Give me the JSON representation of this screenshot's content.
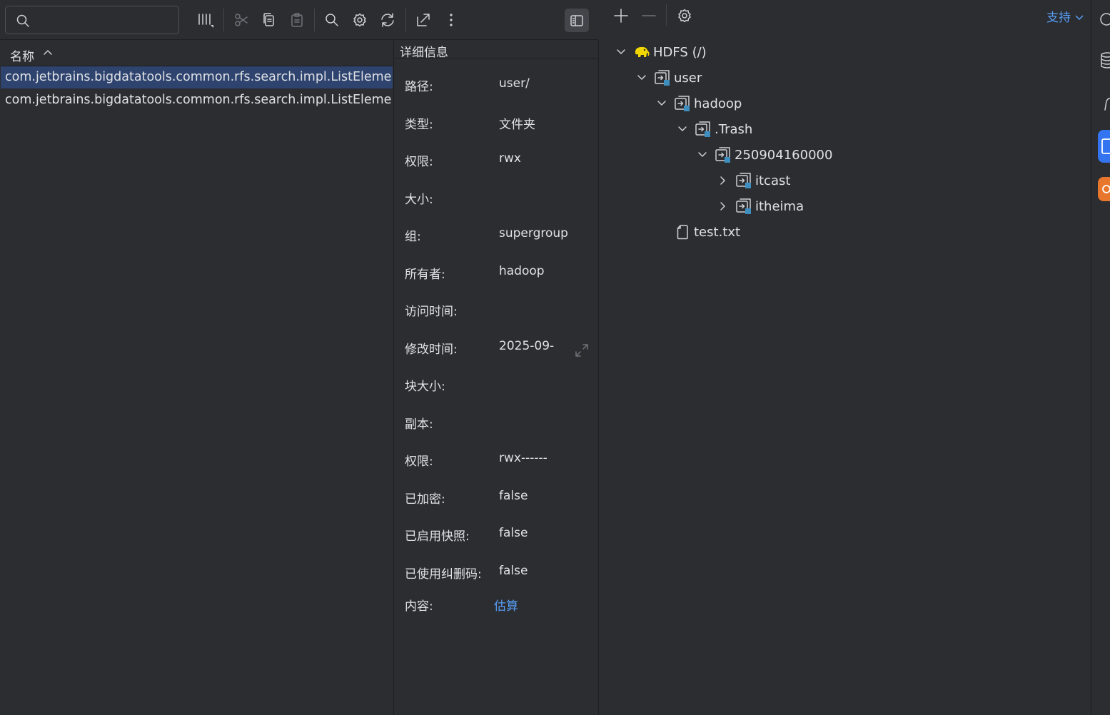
{
  "search": {
    "placeholder": "",
    "value": ""
  },
  "file_list": {
    "column_header": "名称",
    "rows": [
      {
        "name": "com.jetbrains.bigdatatools.common.rfs.search.impl.ListElementCo",
        "selected": true
      },
      {
        "name": "com.jetbrains.bigdatatools.common.rfs.search.impl.ListElementCo",
        "selected": false
      }
    ]
  },
  "details": {
    "title": "详细信息",
    "fields": [
      {
        "label": "路径:",
        "value": "user/"
      },
      {
        "label": "类型:",
        "value": "文件夹"
      },
      {
        "label": "权限:",
        "value": "rwx"
      },
      {
        "label": "大小:",
        "value": ""
      },
      {
        "label": "组:",
        "value": "supergroup"
      },
      {
        "label": "所有者:",
        "value": "hadoop"
      },
      {
        "label": "访问时间:",
        "value": ""
      },
      {
        "label": "修改时间:",
        "value": "2025-09-"
      },
      {
        "label": "块大小:",
        "value": ""
      },
      {
        "label": "副本:",
        "value": ""
      },
      {
        "label": "权限:",
        "value": "rwx------"
      },
      {
        "label": "已加密:",
        "value": "false"
      },
      {
        "label": "已启用快照:",
        "value": "false"
      },
      {
        "label": "已使用纠删码:",
        "value": "false"
      }
    ],
    "content_label": "内容:",
    "content_link": "估算"
  },
  "tree": {
    "support_label": "支持",
    "nodes": [
      {
        "label": "HDFS (/)",
        "type": "root",
        "expanded": true
      },
      {
        "label": "user",
        "type": "folder",
        "expanded": true
      },
      {
        "label": "hadoop",
        "type": "folder",
        "expanded": true
      },
      {
        "label": ".Trash",
        "type": "folder",
        "expanded": true
      },
      {
        "label": "250904160000",
        "type": "folder",
        "expanded": true
      },
      {
        "label": "itcast",
        "type": "folder",
        "expanded": false
      },
      {
        "label": "itheima",
        "type": "folder",
        "expanded": false
      },
      {
        "label": "test.txt",
        "type": "file"
      }
    ]
  },
  "colors": {
    "background": "#2b2d30",
    "selection": "#2e436e",
    "link": "#589df6",
    "accent_strip_blue": "#3574f0",
    "accent_strip_orange": "#e8762d",
    "hdfs_logo": "#f2d600"
  },
  "icons": {
    "toolbar": [
      "search-icon",
      "columns-icon",
      "cut-icon",
      "copy-icon",
      "paste-icon",
      "find-icon",
      "settings-icon",
      "refresh-icon",
      "open-external-icon",
      "more-icon",
      "details-panel-toggle-icon"
    ],
    "tree_toolbar": [
      "add-icon",
      "remove-icon",
      "settings-icon"
    ]
  }
}
